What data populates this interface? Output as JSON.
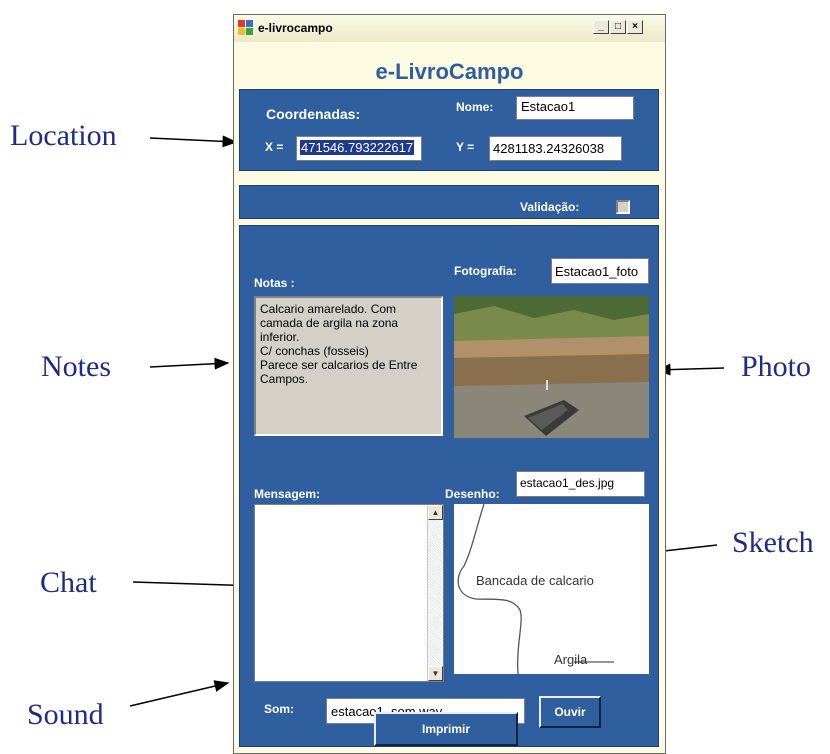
{
  "annotations": {
    "location": "Location",
    "notes": "Notes",
    "photo": "Photo",
    "sketch": "Sketch",
    "chat": "Chat",
    "sound": "Sound"
  },
  "window": {
    "title": "e-livrocampo",
    "minimize_glyph": "_",
    "maximize_glyph": "□",
    "close_glyph": "×"
  },
  "app": {
    "heading": "e-LivroCampo",
    "coords_label": "Coordenadas:",
    "name_label": "Nome:",
    "name_value": "Estacao1",
    "x_label": "X =",
    "x_value": "471546.793222617",
    "y_label": "Y =",
    "y_value": "4281183.24326038",
    "validation_label": "Validação:",
    "validation_checked": false,
    "notes_label": "Notas :",
    "notes_text": "Calcario amarelado. Com camada de argila na zona inferior.\nC/ conchas (fosseis)\nParece ser calcarios de Entre Campos.",
    "photo_label": "Fotografia:",
    "photo_value": "Estacao1_foto",
    "message_label": "Mensagem:",
    "message_value": "",
    "sketch_label": "Desenho:",
    "sketch_value": "estacao1_des.jpg",
    "sketch_text_1": "Bancada de calcario",
    "sketch_text_2": "Argila",
    "sound_label": "Som:",
    "sound_value": "estacao1_som.wav",
    "listen_button": "Ouvir",
    "print_button": "Imprimir"
  },
  "colors": {
    "panel_blue": "#2f5f9e",
    "window_bg": "#fdfbe2",
    "annotation_text": "#1f2b86",
    "heading_blue": "#2d5f9e"
  }
}
